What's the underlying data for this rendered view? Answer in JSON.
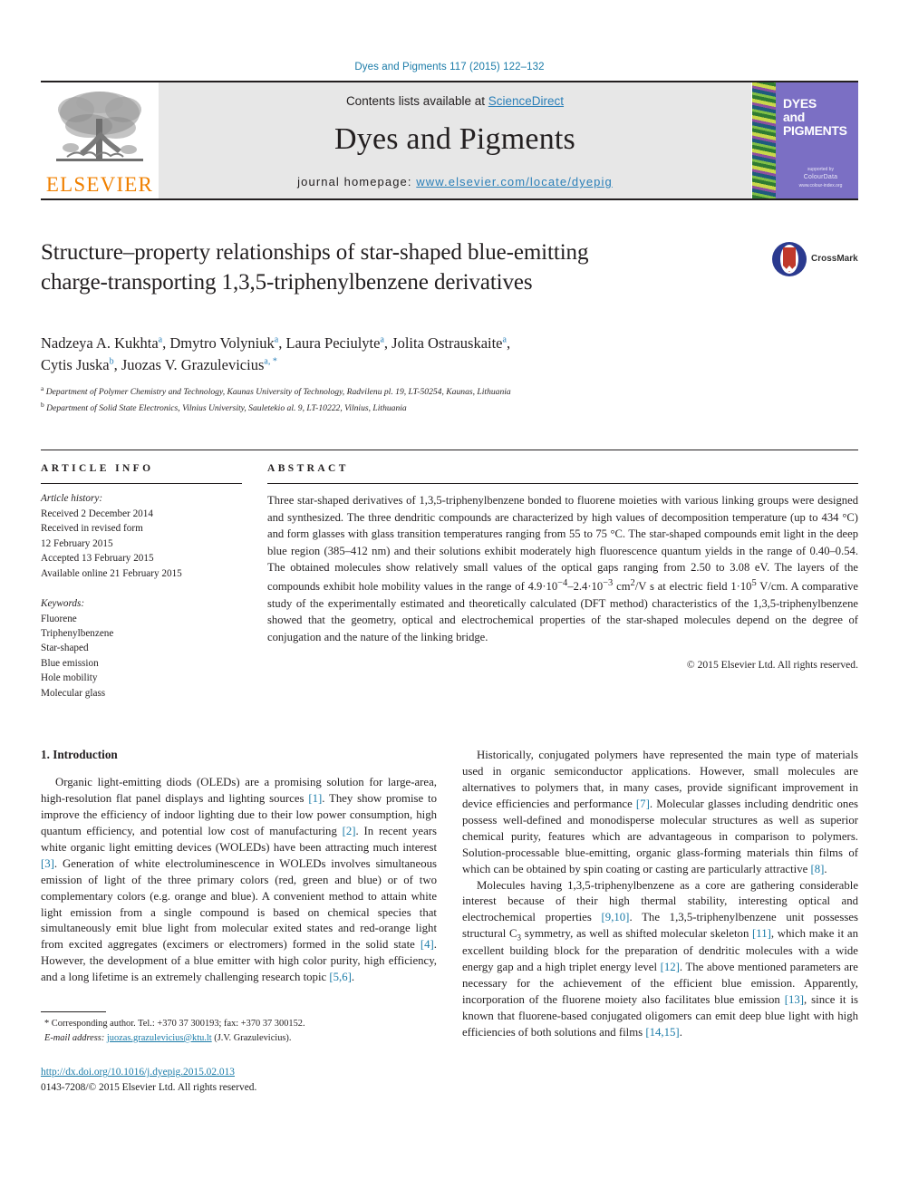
{
  "running_head": "Dyes and Pigments 117 (2015) 122–132",
  "masthead": {
    "publisher_logo_text": "ELSEVIER",
    "contents_prefix": "Contents lists available at ",
    "contents_link": "ScienceDirect",
    "journal_title": "Dyes and Pigments",
    "homepage_prefix": "journal homepage: ",
    "homepage_url": "www.elsevier.com/locate/dyepig",
    "cover": {
      "line1": "DYES",
      "line2": "and",
      "line3": "PIGMENTS",
      "footer_small": "supported by",
      "footer_mark": "ColourData",
      "footer_tiny": "www.colour-index.org"
    }
  },
  "article": {
    "title_line1": "Structure–property relationships of star-shaped blue-emitting",
    "title_line2": "charge-transporting 1,3,5-triphenylbenzene derivatives",
    "crossmark_label": "CrossMark",
    "authors": [
      {
        "name": "Nadzeya A. Kukhta",
        "marks": "a",
        "sep": ", "
      },
      {
        "name": "Dmytro Volyniuk",
        "marks": "a",
        "sep": ", "
      },
      {
        "name": "Laura Peciulyte",
        "marks": "a",
        "sep": ", "
      },
      {
        "name": "Jolita Ostrauskaite",
        "marks": "a",
        "sep": ", "
      },
      {
        "name": "Cytis Juska",
        "marks": "b",
        "sep": ", "
      },
      {
        "name": "Juozas V. Grazulevicius",
        "marks": "a, *",
        "sep": ""
      }
    ],
    "affiliations": [
      {
        "mark": "a",
        "text": "Department of Polymer Chemistry and Technology, Kaunas University of Technology, Radvilenu pl. 19, LT-50254, Kaunas, Lithuania"
      },
      {
        "mark": "b",
        "text": "Department of Solid State Electronics, Vilnius University, Sauletekio al. 9, LT-10222, Vilnius, Lithuania"
      }
    ]
  },
  "article_info": {
    "heading": "ARTICLE INFO",
    "history_label": "Article history:",
    "history": [
      "Received 2 December 2014",
      "Received in revised form",
      "12 February 2015",
      "Accepted 13 February 2015",
      "Available online 21 February 2015"
    ],
    "keywords_label": "Keywords:",
    "keywords": [
      "Fluorene",
      "Triphenylbenzene",
      "Star-shaped",
      "Blue emission",
      "Hole mobility",
      "Molecular glass"
    ]
  },
  "abstract": {
    "heading": "ABSTRACT",
    "text_part1": "Three star-shaped derivatives of 1,3,5-triphenylbenzene bonded to fluorene moieties with various linking groups were designed and synthesized. The three dendritic compounds are characterized by high values of decomposition temperature (up to 434 °C) and form glasses with glass transition temperatures ranging from 55 to 75 °C. The star-shaped compounds emit light in the deep blue region (385–412 nm) and their solutions exhibit moderately high fluorescence quantum yields in the range of 0.40–0.54. The obtained molecules show relatively small values of the optical gaps ranging from 2.50 to 3.08 eV. The layers of the compounds exhibit hole mobility values in the range of 4.9·10",
    "exp1": "−4",
    "text_part2": "–2.4·10",
    "exp2": "−3",
    "text_part3": " cm",
    "exp3": "2",
    "text_part4": "/V s at electric field 1·10",
    "exp4": "5",
    "text_part5": " V/cm. A comparative study of the experimentally estimated and theoretically calculated (DFT method) characteristics of the 1,3,5-triphenylbenzene showed that the geometry, optical and electrochemical properties of the star-shaped molecules depend on the degree of conjugation and the nature of the linking bridge.",
    "copyright": "© 2015 Elsevier Ltd. All rights reserved."
  },
  "introduction": {
    "heading": "1. Introduction",
    "left_paragraphs": [
      "Organic light-emitting diods (OLEDs) are a promising solution for large-area, high-resolution flat panel displays and lighting sources [1]. They show promise to improve the efficiency of indoor lighting due to their low power consumption, high quantum efficiency, and potential low cost of manufacturing [2]. In recent years white organic light emitting devices (WOLEDs) have been attracting much interest [3]. Generation of white electroluminescence in WOLEDs involves simultaneous emission of light of the three primary colors (red, green and blue) or of two complementary colors (e.g. orange and blue). A convenient method to attain white light emission from a single compound is based on chemical species that simultaneously emit blue light from molecular exited states and red-orange light from excited aggregates (excimers or electromers) formed in the solid state [4]. However, the development of a blue emitter with high color purity, high efficiency, and a long lifetime is an extremely challenging research topic [5,6]."
    ],
    "right_paragraphs": [
      "Historically, conjugated polymers have represented the main type of materials used in organic semiconductor applications. However, small molecules are alternatives to polymers that, in many cases, provide significant improvement in device efficiencies and performance [7]. Molecular glasses including dendritic ones possess well-defined and monodisperse molecular structures as well as superior chemical purity, features which are advantageous in comparison to polymers. Solution-processable blue-emitting, organic glass-forming materials thin films of which can be obtained by spin coating or casting are particularly attractive [8].",
      "Molecules having 1,3,5-triphenylbenzene as a core are gathering considerable interest because of their high thermal stability, interesting optical and electrochemical properties [9,10]. The 1,3,5-triphenylbenzene unit possesses structural C3 symmetry, as well as shifted molecular skeleton [11], which make it an excellent building block for the preparation of dendritic molecules with a wide energy gap and a high triplet energy level [12]. The above mentioned parameters are necessary for the achievement of the efficient blue emission. Apparently, incorporation of the fluorene moiety also facilitates blue emission [13], since it is known that fluorene-based conjugated oligomers can emit deep blue light with high efficiencies of both solutions and films [14,15]."
    ]
  },
  "footer": {
    "corresponding_note": "* Corresponding author. Tel.: +370 37 300193; fax: +370 37 300152.",
    "email_label": "E-mail address:",
    "email": "juozas.grazulevicius@ktu.lt",
    "email_owner": "(J.V. Grazulevicius).",
    "doi_url": "http://dx.doi.org/10.1016/j.dyepig.2015.02.013",
    "issn_line": "0143-7208/© 2015 Elsevier Ltd. All rights reserved."
  },
  "colors": {
    "link_blue": "#1a7ba8",
    "elsevier_orange": "#f08000",
    "band_gray": "#e7e7e7",
    "cover_purple": "#7b6fc4"
  }
}
